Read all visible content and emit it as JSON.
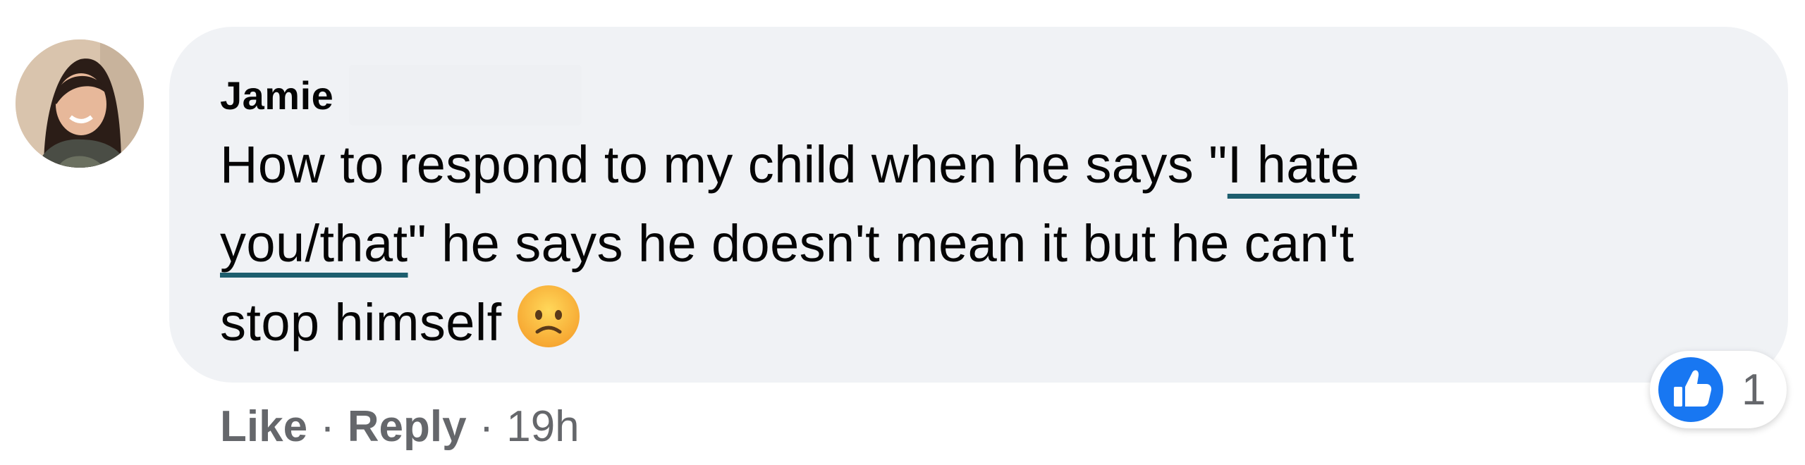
{
  "comment": {
    "author": "Jamie",
    "text_lines": [
      {
        "before": "How to respond to my child when he says \"",
        "link": "I hate"
      },
      {
        "link": "you/that",
        "after": "\" he says he doesn't mean it but he can't"
      },
      {
        "text": "stop himself"
      }
    ],
    "emoji": "sad-face-icon",
    "actions": {
      "like": "Like",
      "separator": "·",
      "reply": "Reply",
      "time": "19h"
    },
    "reactions": {
      "icon": "like-thumb-icon",
      "count": "1",
      "color": "#1877f2"
    }
  }
}
